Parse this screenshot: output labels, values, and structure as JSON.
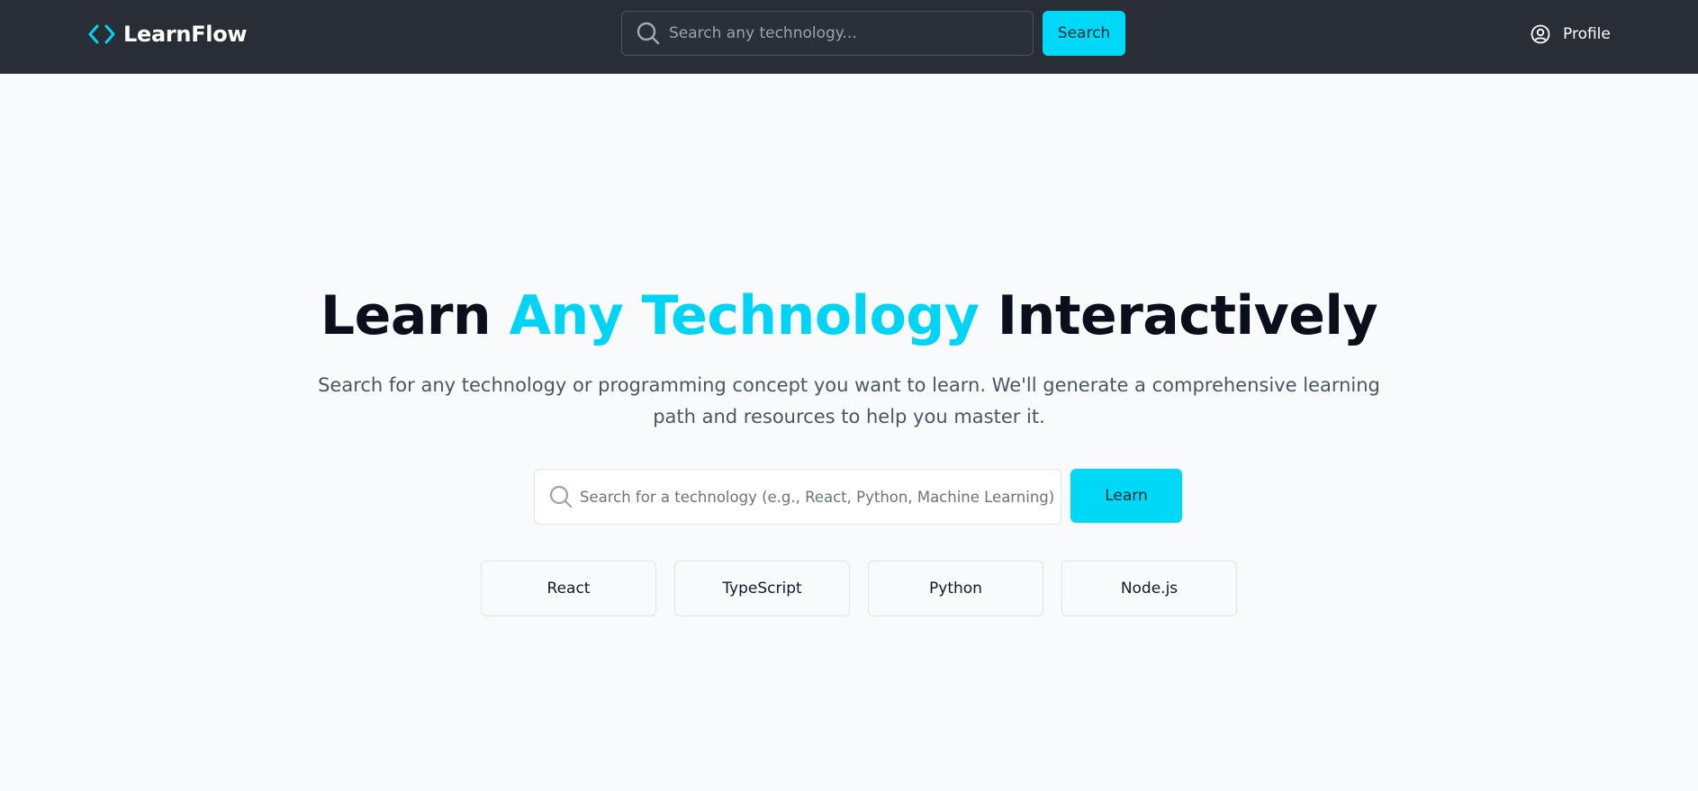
{
  "app": {
    "name": "LearnFlow",
    "logo_icon": "code-brackets-icon",
    "accent_color": "#00d8f7",
    "nav_background": "#292d36"
  },
  "header": {
    "search_placeholder": "Search any technology...",
    "search_button": "Search",
    "profile_label": "Profile",
    "profile_icon": "user-circle-icon"
  },
  "hero": {
    "title_before": "Learn ",
    "title_accent": "Any Technology",
    "title_after": " Interactively",
    "subtitle": "Search for any technology or programming concept you want to learn. We'll generate a comprehensive learning path and resources to help you master it.",
    "search_placeholder": "Search for a technology (e.g., React, Python, Machine Learning)",
    "learn_button": "Learn"
  },
  "suggestions": [
    "React",
    "TypeScript",
    "Python",
    "Node.js"
  ]
}
